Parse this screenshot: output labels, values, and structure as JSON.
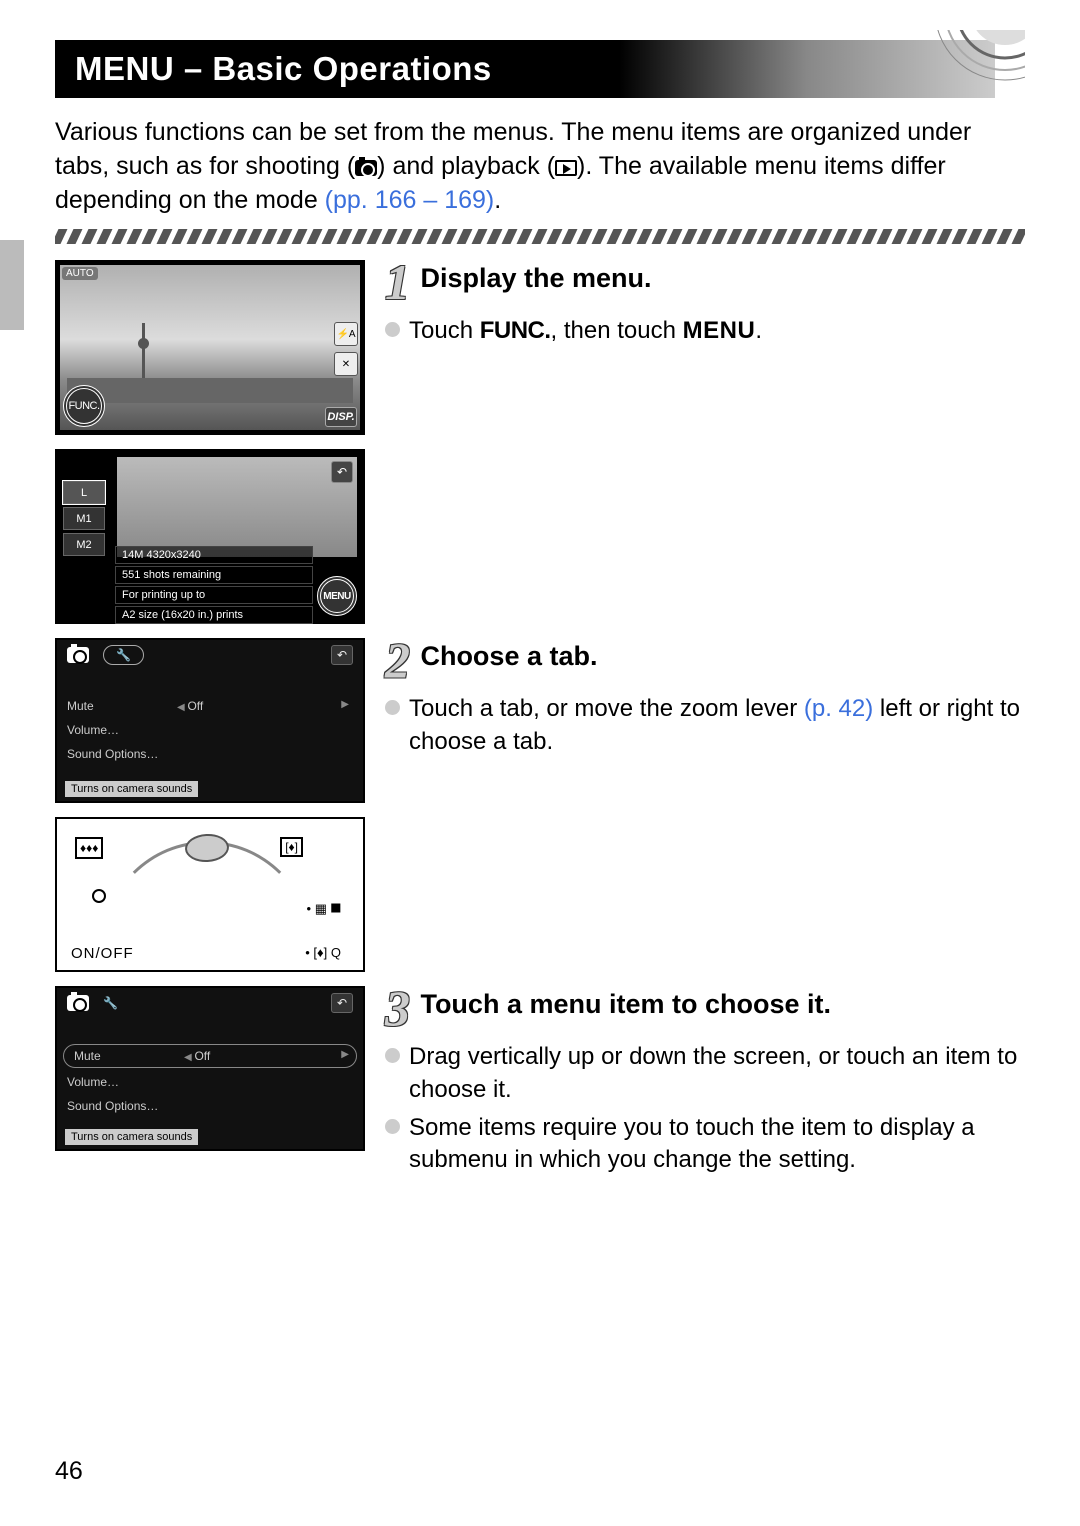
{
  "page_number": "46",
  "title": "MENU – Basic Operations",
  "intro": {
    "part1": "Various functions can be set from the menus. The menu items are organized under tabs, such as for shooting (",
    "part2": ") and playback (",
    "part3": "). The available menu items differ depending on the mode ",
    "link_open": "(pp. 166",
    "link_dash": " – ",
    "link_close": "169)",
    "period": "."
  },
  "steps": [
    {
      "num": "1",
      "title": "Display the menu.",
      "bullets": [
        {
          "pre": "Touch ",
          "func": "FUNC.",
          "mid": ", then touch ",
          "menu": "MENU",
          "post": "."
        }
      ]
    },
    {
      "num": "2",
      "title": "Choose a tab.",
      "bullets": [
        {
          "pre": "Touch a tab, or move the zoom lever ",
          "link": "(p. 42)",
          "post": " left or right to choose a tab."
        }
      ]
    },
    {
      "num": "3",
      "title": "Touch a menu item to choose it.",
      "bullets": [
        {
          "text": "Drag vertically up or down the screen, or touch an item to choose it."
        },
        {
          "text": "Some items require you to touch the item to display a submenu in which you change the setting."
        }
      ]
    }
  ],
  "screenshot1": {
    "auto": "AUTO",
    "func": "FUNC.",
    "disp": "DISP.",
    "flash": "⚡A"
  },
  "screenshot2": {
    "sizes": [
      "L",
      "M1",
      "M2"
    ],
    "info_a": "14M 4320x3240",
    "info_b": "551 shots remaining",
    "info_c": "For printing up to",
    "info_d": "A2 size (16x20 in.) prints",
    "menu": "MENU"
  },
  "menuscreen": {
    "mute": "Mute",
    "off": "Off",
    "volume": "Volume…",
    "sound_options": "Sound Options…",
    "hint": "Turns on camera sounds"
  },
  "lever": {
    "wide": "♦♦♦",
    "tele": "[♦]",
    "onoff": "ON/OFF",
    "r1a": "• ▦ ⯀",
    "r2a": "• [♦] Q"
  }
}
